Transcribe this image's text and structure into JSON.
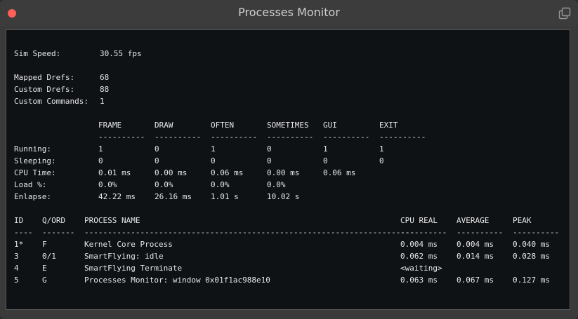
{
  "window": {
    "title": "Processes Monitor"
  },
  "sim": {
    "speed_label": "Sim Speed:",
    "speed_value": "30.55 fps"
  },
  "drefs": {
    "mapped_label": "Mapped Drefs:",
    "mapped_value": "68",
    "custom_label": "Custom Drefs:",
    "custom_value": "88",
    "commands_label": "Custom Commands:",
    "commands_value": "1"
  },
  "phases": {
    "headers": [
      "FRAME",
      "DRAW",
      "OFTEN",
      "SOMETIMES",
      "GUI",
      "EXIT"
    ],
    "underline": "----------",
    "rows": [
      {
        "label": "Running:",
        "values": [
          "1",
          "0",
          "1",
          "0",
          "1",
          "1"
        ]
      },
      {
        "label": "Sleeping:",
        "values": [
          "0",
          "0",
          "0",
          "0",
          "0",
          "0"
        ]
      },
      {
        "label": "CPU Time:",
        "values": [
          "0.01 ms",
          "0.00 ms",
          "0.06 ms",
          "0.00 ms",
          "0.06 ms",
          ""
        ]
      },
      {
        "label": "Load %:",
        "values": [
          "0.0%",
          "0.0%",
          "0.0%",
          "0.0%",
          "",
          ""
        ]
      },
      {
        "label": "Enlapse:",
        "values": [
          "42.22 ms",
          "26.16 ms",
          "1.01 s",
          "10.02 s",
          "",
          ""
        ]
      }
    ]
  },
  "processes": {
    "headers": {
      "id": "ID",
      "qord": "Q/ORD",
      "name": "PROCESS NAME",
      "cpu_real": "CPU REAL",
      "average": "AVERAGE",
      "peak": "PEAK"
    },
    "underlines": {
      "id": "----",
      "qord": "-------",
      "name": "-----------------------------------------------------------------------",
      "cpu_real": "----------",
      "average": "----------",
      "peak": "----------"
    },
    "rows": [
      {
        "id": "1*",
        "qord": "F",
        "name": "Kernel Core Process",
        "cpu_real": "0.004 ms",
        "average": "0.004 ms",
        "peak": "0.040 ms"
      },
      {
        "id": "3",
        "qord": "0/1",
        "name": "SmartFlying: idle",
        "cpu_real": "0.062 ms",
        "average": "0.014 ms",
        "peak": "0.028 ms"
      },
      {
        "id": "4",
        "qord": "E",
        "name": "SmartFlying Terminate",
        "cpu_real": "<waiting>",
        "average": "",
        "peak": ""
      },
      {
        "id": "5",
        "qord": "G",
        "name": "Processes Monitor: window 0x01f1ac988e10",
        "cpu_real": "0.063 ms",
        "average": "0.067 ms",
        "peak": "0.127 ms"
      }
    ]
  }
}
